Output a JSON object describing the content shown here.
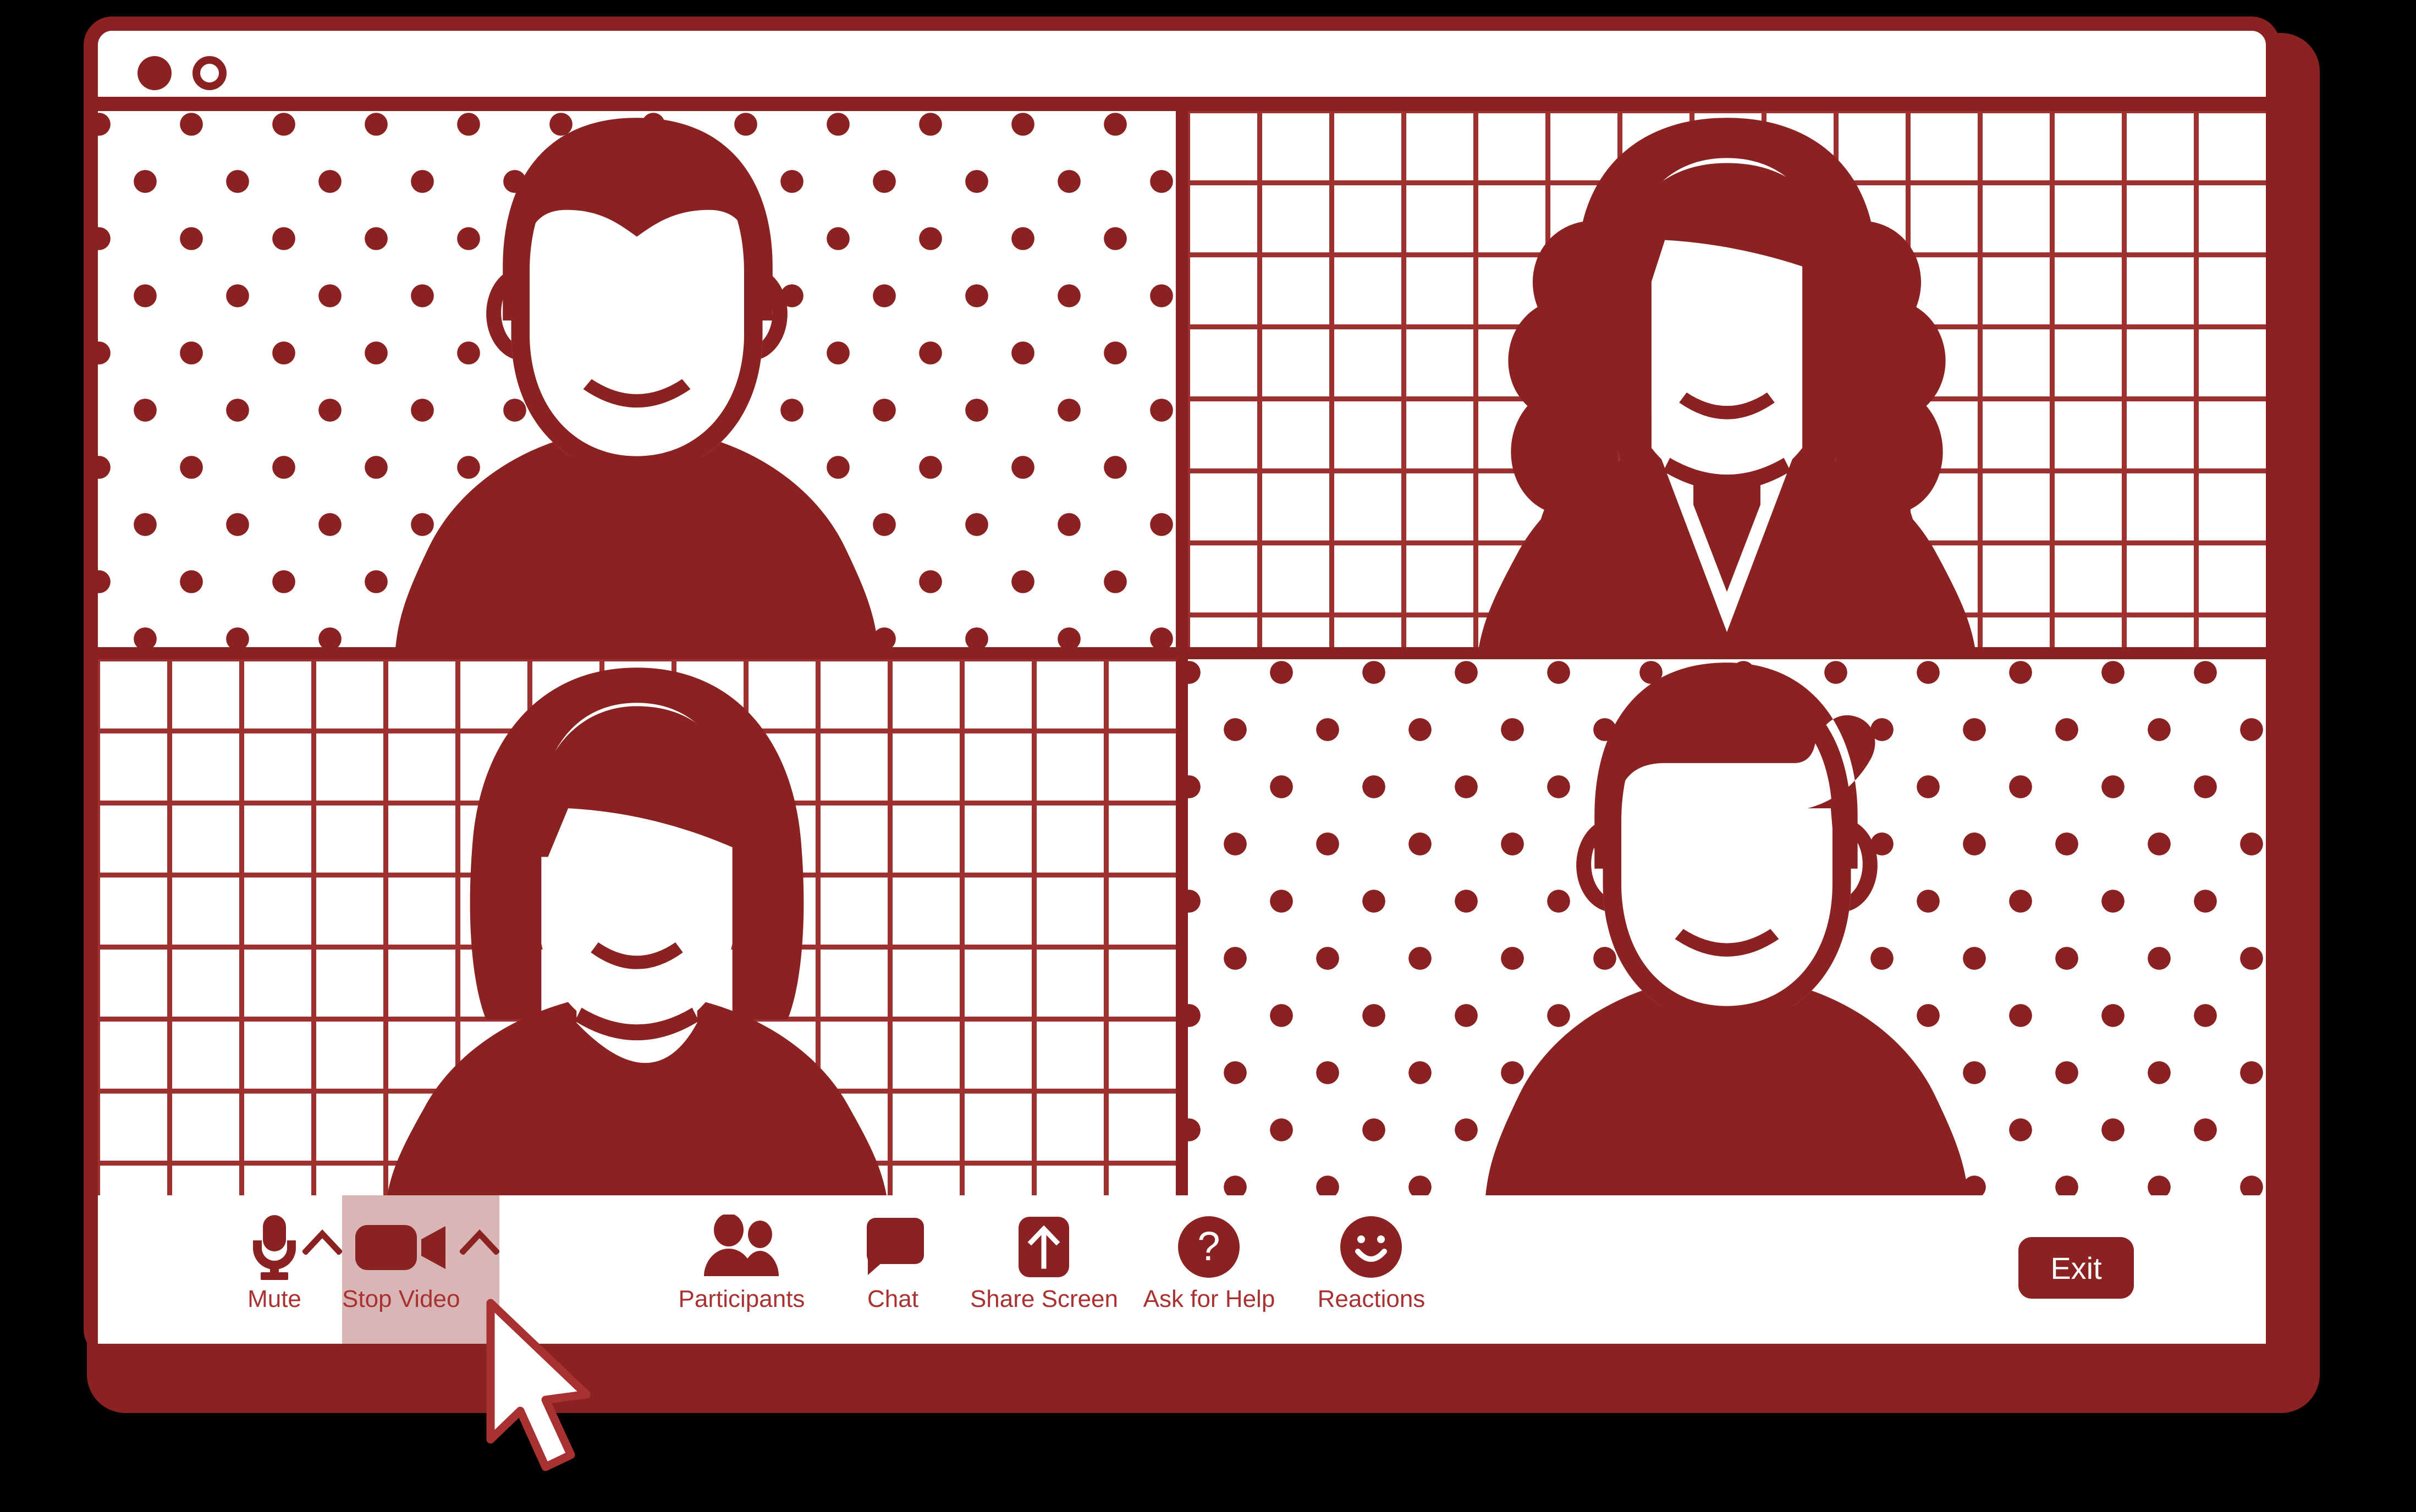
{
  "window": {
    "traffic_lights": [
      {
        "name": "filled-dot",
        "style": "filled"
      },
      {
        "name": "hollow-dot",
        "style": "hollow"
      }
    ]
  },
  "colors": {
    "brand_red": "#8B2222",
    "grid_line_red": "#9E3030",
    "label_red": "#A83232",
    "highlight_pink": "#D9B5B5",
    "tile_white": "#FFFFFF",
    "page_black": "#000000"
  },
  "video_grid": {
    "tiles": [
      {
        "id": "tile-1",
        "background": "dots",
        "avatar": "man-short-hair",
        "position": "top-left"
      },
      {
        "id": "tile-2",
        "background": "grid",
        "avatar": "woman-curly-hair",
        "position": "top-right"
      },
      {
        "id": "tile-3",
        "background": "grid",
        "avatar": "woman-bob-hair",
        "position": "bottom-left"
      },
      {
        "id": "tile-4",
        "background": "dots",
        "avatar": "man-quiff-hair",
        "position": "bottom-right"
      }
    ]
  },
  "toolbar": {
    "buttons": [
      {
        "key": "mute",
        "label": "Mute",
        "icon": "microphone-icon",
        "has_chevron": true,
        "active": false
      },
      {
        "key": "stop_video",
        "label": "Stop Video",
        "icon": "video-camera-icon",
        "has_chevron": true,
        "active": true
      },
      {
        "key": "participants",
        "label": "Participants",
        "icon": "people-icon",
        "has_chevron": false,
        "active": false
      },
      {
        "key": "chat",
        "label": "Chat",
        "icon": "chat-bubble-icon",
        "has_chevron": false,
        "active": false
      },
      {
        "key": "share_screen",
        "label": "Share Screen",
        "icon": "upload-arrow-icon",
        "has_chevron": false,
        "active": false
      },
      {
        "key": "ask_for_help",
        "label": "Ask for Help",
        "icon": "question-mark-icon",
        "has_chevron": false,
        "active": false
      },
      {
        "key": "reactions",
        "label": "Reactions",
        "icon": "smiley-face-icon",
        "has_chevron": false,
        "active": false
      }
    ],
    "chevron_icon": "chevron-up-icon",
    "exit_label": "Exit"
  },
  "cursor": {
    "icon": "mouse-pointer-icon",
    "pointing_at": "Stop Video"
  }
}
